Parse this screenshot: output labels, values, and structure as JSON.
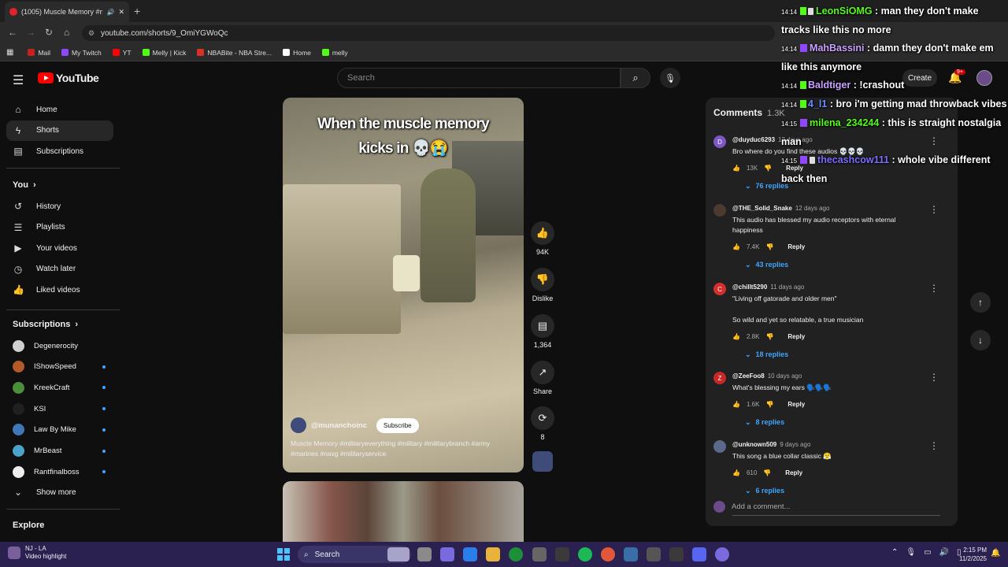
{
  "browser": {
    "tab_title": "(1005) Muscle Memory #m",
    "url": "youtube.com/shorts/9_OmiYGWoQc",
    "bookmarks": [
      {
        "label": "Mail",
        "color": "#c5221f"
      },
      {
        "label": "My Twitch",
        "color": "#9147ff"
      },
      {
        "label": "YT",
        "color": "#ff0000"
      },
      {
        "label": "Melly | Kick",
        "color": "#53fc18"
      },
      {
        "label": "NBABite - NBA Stre...",
        "color": "#d93025"
      },
      {
        "label": "Home",
        "color": "#ffffff"
      },
      {
        "label": "melly",
        "color": "#53fc18"
      }
    ]
  },
  "header": {
    "logo": "YouTube",
    "search_placeholder": "Search",
    "create_label": "Create",
    "notif_count": "9+"
  },
  "sidebar": {
    "primary": [
      {
        "label": "Home",
        "icon": "home-icon",
        "glyph": "⌂"
      },
      {
        "label": "Shorts",
        "icon": "shorts-icon",
        "glyph": "ϟ",
        "active": true
      },
      {
        "label": "Subscriptions",
        "icon": "subscriptions-icon",
        "glyph": "▤"
      }
    ],
    "you_heading": "You",
    "you_items": [
      {
        "label": "History",
        "icon": "history-icon",
        "glyph": "↺"
      },
      {
        "label": "Playlists",
        "icon": "playlists-icon",
        "glyph": "☰"
      },
      {
        "label": "Your videos",
        "icon": "your-videos-icon",
        "glyph": "▶"
      },
      {
        "label": "Watch later",
        "icon": "watch-later-icon",
        "glyph": "◷"
      },
      {
        "label": "Liked videos",
        "icon": "liked-videos-icon",
        "glyph": "👍"
      }
    ],
    "subscriptions_heading": "Subscriptions",
    "subscriptions": [
      {
        "label": "Degenerocity",
        "color": "#d0d0d0",
        "dot": false
      },
      {
        "label": "IShowSpeed",
        "color": "#b35a2b",
        "dot": true
      },
      {
        "label": "KreekCraft",
        "color": "#4a8f3a",
        "dot": true
      },
      {
        "label": "KSI",
        "color": "#202020",
        "dot": true
      },
      {
        "label": "Law By Mike",
        "color": "#3f79b5",
        "dot": true
      },
      {
        "label": "MrBeast",
        "color": "#4aa3c8",
        "dot": true
      },
      {
        "label": "Rantfinalboss",
        "color": "#eeeeee",
        "dot": true
      }
    ],
    "show_more": "Show more",
    "explore_heading": "Explore"
  },
  "video": {
    "caption_line1": "When the muscle memory",
    "caption_line2": "kicks in 💀😭",
    "channel": "@munanchoinc",
    "subscribe_label": "Subscribe",
    "description": "Muscle Memory #militaryeverything #military #militarybranch #army #marines #navg #militaryservice"
  },
  "actions": {
    "likes": "94K",
    "dislike_label": "Dislike",
    "comments": "1,364",
    "share_label": "Share",
    "remix": "8"
  },
  "comments": {
    "heading": "Comments",
    "count": "1.3K",
    "add_placeholder": "Add a comment...",
    "reply_label": "Reply",
    "items": [
      {
        "user": "@duyduc6293",
        "ago": "12 days ago",
        "text": "Bro where do you find these audios 💀💀💀",
        "likes": "13K",
        "replies": "76 replies",
        "avatar_letter": "D",
        "avatar_color": "#7e57c2"
      },
      {
        "user": "@THE_Solid_Snake",
        "ago": "12 days ago",
        "text": "This audio has blessed my audio receptors with eternal happiness",
        "likes": "7.4K",
        "replies": "43 replies",
        "avatar_letter": "",
        "avatar_color": "#4a3a30"
      },
      {
        "user": "@chillt5290",
        "ago": "11 days ago",
        "text": "\"Living off gatorade and older men\"",
        "text2": "So wild and yet so relatable, a true musician",
        "likes": "2.8K",
        "replies": "18 replies",
        "avatar_letter": "C",
        "avatar_color": "#d32f2f"
      },
      {
        "user": "@ZeeFoo8",
        "ago": "10 days ago",
        "text": "What's blessing my ears 🗣️🗣️🗣️",
        "likes": "1.6K",
        "replies": "8 replies",
        "avatar_letter": "Z",
        "avatar_color": "#c62828"
      },
      {
        "user": "@unknown509",
        "ago": "9 days ago",
        "text": "This song a blue collar classic 😤",
        "likes": "610",
        "replies": "6 replies",
        "avatar_letter": "",
        "avatar_color": "#5a6a8a"
      }
    ]
  },
  "chat": [
    {
      "time": "14:14",
      "badge": "kick",
      "user": "LeonSiOMG",
      "user_color": "#53fc18",
      "msg": ": man they don't make tracks like this no more"
    },
    {
      "time": "14:14",
      "badge": "twitch",
      "user": "MahBassini",
      "user_color": "#c9a0ff",
      "msg": ": damn they don't make em like this anymore"
    },
    {
      "time": "14:14",
      "badge": "kick",
      "user": "Baldtiger",
      "user_color": "#c9a0ff",
      "msg": ": !crashout"
    },
    {
      "time": "14:14",
      "badge": "kick",
      "user": "4_l1",
      "user_color": "#6a8cff",
      "msg": ": bro i'm getting mad throwback vibes"
    },
    {
      "time": "14:15",
      "badge": "twitch",
      "user": "milena_234244",
      "user_color": "#53fc18",
      "msg": ": this is straight nostalgia man"
    },
    {
      "time": "14:15",
      "badge": "twitch",
      "user": "thecashcow111",
      "user_color": "#7c6cff",
      "msg": ": whole vibe different back then"
    }
  ],
  "taskbar": {
    "weather_line1": "NJ - LA",
    "weather_line2": "Video highlight",
    "search_label": "Search",
    "time": "2:15 PM",
    "date": "11/2/2025"
  }
}
